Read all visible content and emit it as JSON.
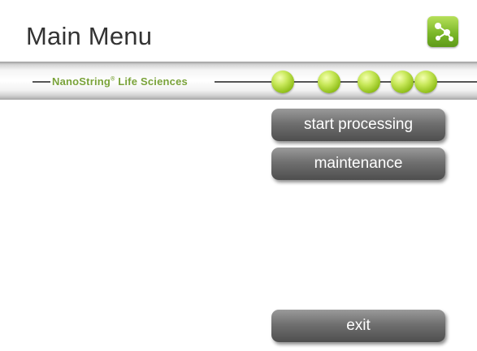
{
  "header": {
    "title": "Main Menu",
    "app_icon": "network-nodes-icon"
  },
  "banner": {
    "brand_name": "NanoString",
    "brand_registered": "®",
    "brand_suffix": "Life Sciences",
    "dot_count": 5
  },
  "menu": {
    "start_processing_label": "start processing",
    "maintenance_label": "maintenance",
    "exit_label": "exit"
  },
  "colors": {
    "accent_green": "#94c21e",
    "brand_text": "#7aa33a",
    "button_gray": "#6a6a6a"
  }
}
